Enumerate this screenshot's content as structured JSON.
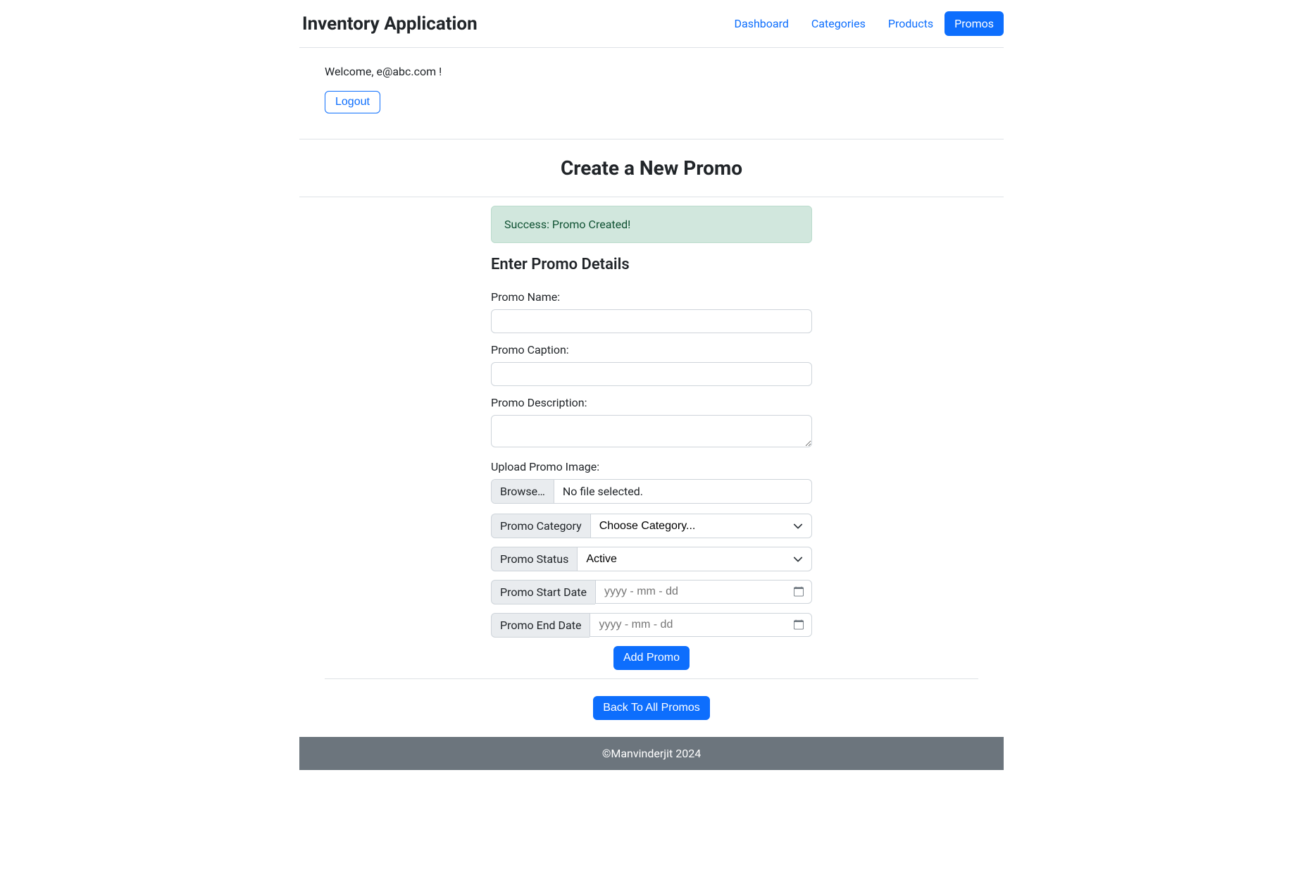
{
  "navbar": {
    "brand": "Inventory Application",
    "links": {
      "dashboard": "Dashboard",
      "categories": "Categories",
      "products": "Products",
      "promos": "Promos"
    }
  },
  "welcome": {
    "text": "Welcome, e@abc.com !",
    "logout": "Logout"
  },
  "page": {
    "title": "Create a New Promo"
  },
  "alert": {
    "success": "Success: Promo Created!"
  },
  "form": {
    "heading": "Enter Promo Details",
    "promoName": {
      "label": "Promo Name:",
      "value": ""
    },
    "promoCaption": {
      "label": "Promo Caption:",
      "value": ""
    },
    "promoDescription": {
      "label": "Promo Description:",
      "value": ""
    },
    "uploadImage": {
      "label": "Upload Promo Image:",
      "browse": "Browse…",
      "noFile": "No file selected."
    },
    "promoCategory": {
      "label": "Promo Category",
      "placeholder": "Choose Category..."
    },
    "promoStatus": {
      "label": "Promo Status",
      "value": "Active"
    },
    "promoStartDate": {
      "label": "Promo Start Date",
      "placeholder": "yyyy - mm - dd"
    },
    "promoEndDate": {
      "label": "Promo End Date",
      "placeholder": "yyyy - mm - dd"
    },
    "submit": "Add Promo"
  },
  "back": {
    "button": "Back To All Promos"
  },
  "footer": {
    "text": "©Manvinderjit 2024"
  }
}
